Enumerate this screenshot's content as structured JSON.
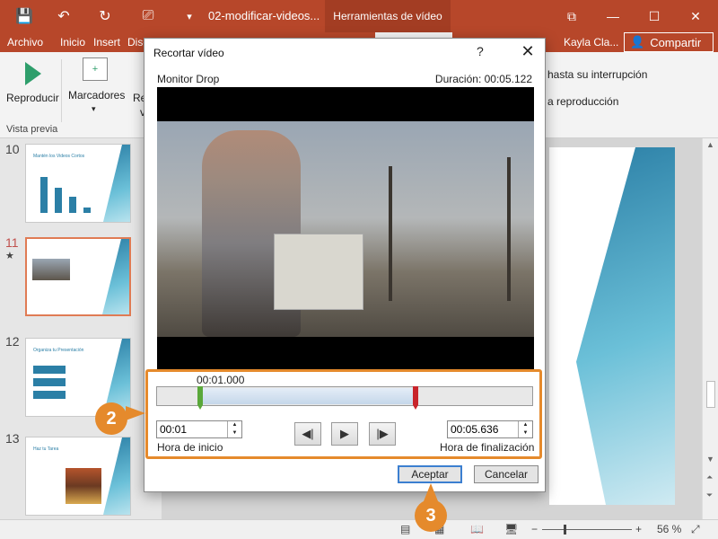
{
  "titlebar": {
    "doc_title": "02-modificar-videos...",
    "tools_tab": "Herramientas de vídeo",
    "colors": {
      "brand": "#b7472a"
    }
  },
  "menu": {
    "items": [
      "Archivo",
      "Inicio",
      "Insert",
      "Disc"
    ],
    "user": "Kayla Cla...",
    "share": "Compartir"
  },
  "ribbon": {
    "play_label": "Reproducir",
    "markers_label": "Marcadores",
    "trim_label_partial": "Re",
    "trim_label_partial2": "v",
    "group_label": "Vista previa",
    "option1": "hasta su interrupción",
    "option2": "a reproducción"
  },
  "slides": [
    {
      "number": "10",
      "title": "Mantén los Videos Cortos"
    },
    {
      "number": "11",
      "title": ""
    },
    {
      "number": "12",
      "title": "Organiza tu Presentación"
    },
    {
      "number": "13",
      "title": "Haz tu Tarea"
    }
  ],
  "slide11_star": "★",
  "dialog": {
    "title": "Recortar vídeo",
    "help": "?",
    "close": "✕",
    "video_name": "Monitor Drop",
    "duration": "Duración: 00:05.122",
    "current_time": "00:01.000",
    "start_time": "00:01",
    "end_time": "00:05.636",
    "start_label": "Hora de inicio",
    "end_label": "Hora de finalización",
    "prev_frame": "◀|",
    "play": "▶",
    "next_frame": "|▶",
    "accept": "Aceptar",
    "cancel": "Cancelar"
  },
  "callouts": {
    "two": "2",
    "three": "3"
  },
  "status": {
    "zoom": "56 %",
    "minus": "−",
    "plus": "+"
  }
}
